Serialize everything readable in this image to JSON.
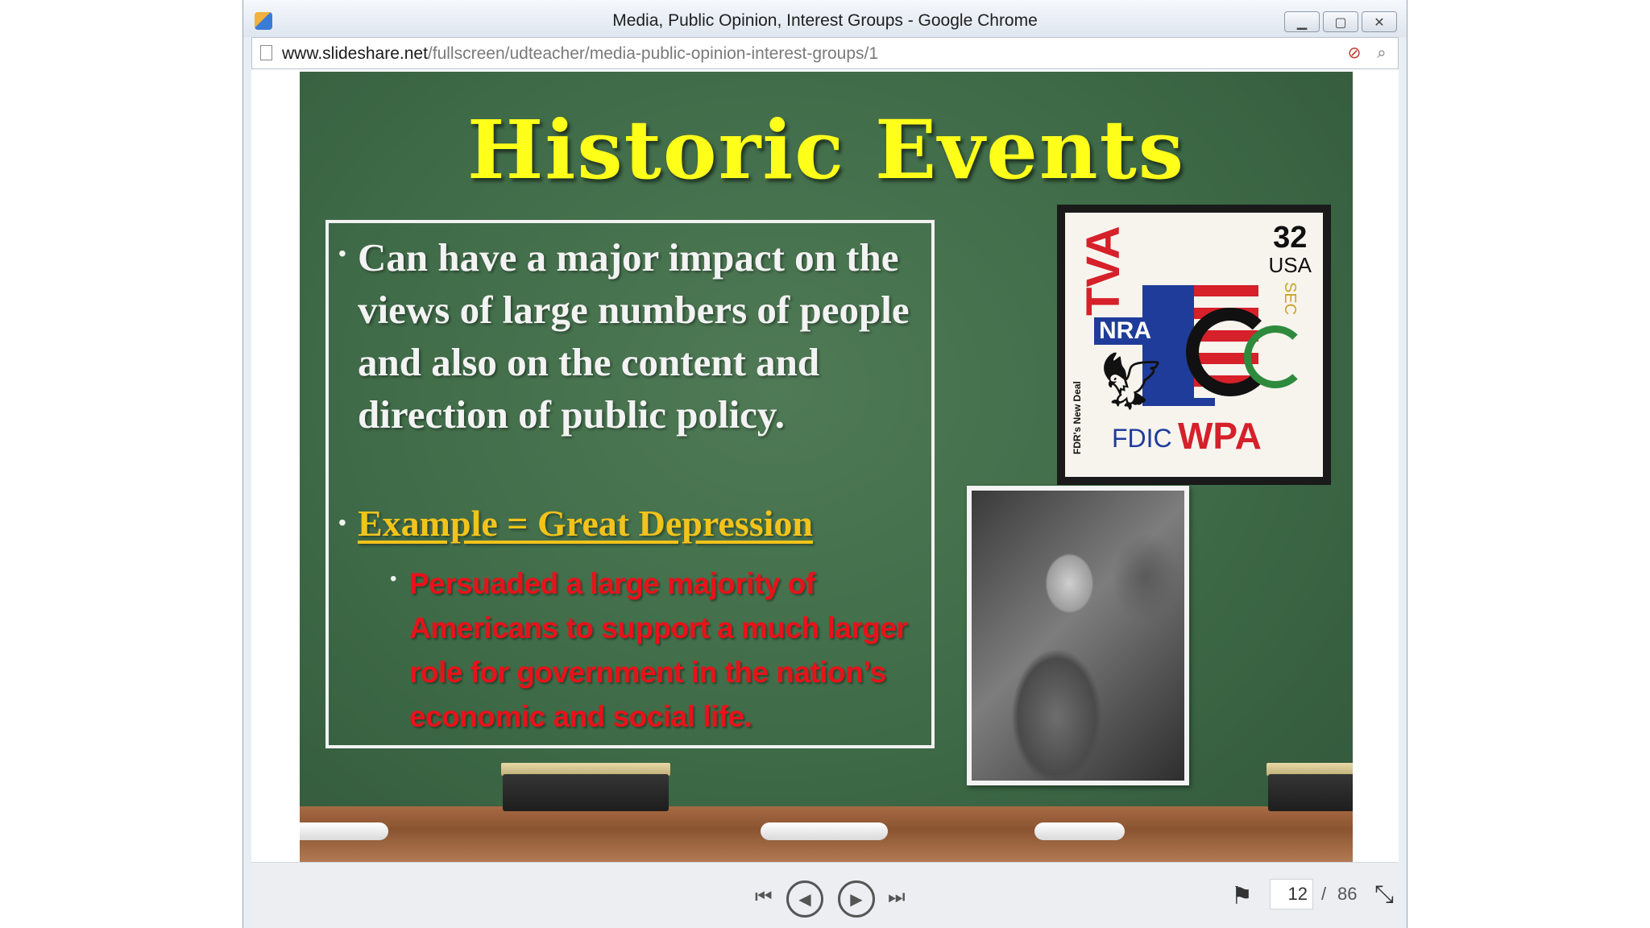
{
  "window": {
    "title": "Media, Public Opinion, Interest Groups - Google Chrome",
    "controls": {
      "minimize": "▁",
      "maximize": "▢",
      "close": "✕"
    }
  },
  "address": {
    "host": "www.slideshare.net",
    "path": "/fullscreen/udteacher/media-public-opinion-interest-groups/1",
    "icons": [
      "blocked-content-icon",
      "zoom-icon"
    ]
  },
  "slide": {
    "title": "Historic Events",
    "bullet1": "Can have a major impact on the views of large numbers of people and also on the content and direction of public policy.",
    "bullet2": "Example = Great Depression",
    "bullet3": "Persuaded a large majority of Americans to support a much larger role for government in the nation’s economic and social life.",
    "stamp": {
      "value": "32",
      "country": "USA",
      "tva": "TVA",
      "nra": "NRA",
      "fdic": "FDIC",
      "wpa": "WPA",
      "sec": "SEC",
      "series": "FDR's New Deal"
    },
    "photo_subject": "photograph"
  },
  "player": {
    "current_page": "12",
    "separator": "/",
    "total_pages": "86",
    "icons": [
      "first-slide-icon",
      "previous-icon",
      "next-icon",
      "last-slide-icon",
      "flag-icon",
      "exit-fullscreen-icon"
    ]
  },
  "colors": {
    "chalkboard": "#3e6a47",
    "title": "#ffff1a",
    "example": "#f2c31b",
    "emphasis": "#e8121a"
  }
}
